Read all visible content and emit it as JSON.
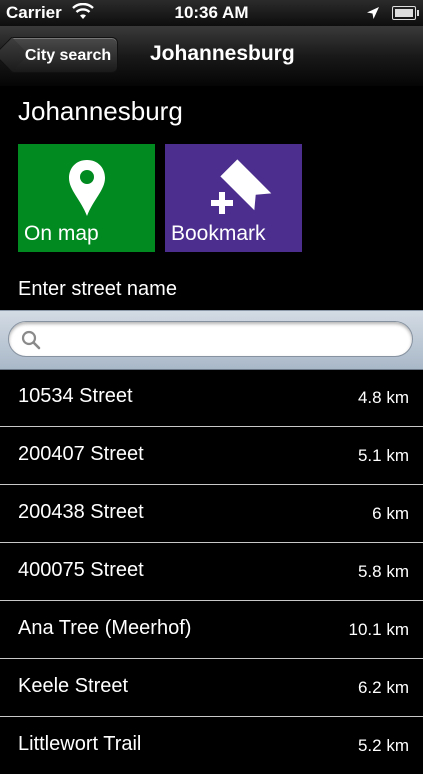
{
  "status_bar": {
    "carrier": "Carrier",
    "time": "10:36 AM",
    "icons": [
      "wifi-icon",
      "location-arrow-icon",
      "battery-icon"
    ]
  },
  "nav": {
    "back_label": "City search",
    "title": "Johannesburg"
  },
  "city": {
    "name": "Johannesburg"
  },
  "actions": {
    "on_map": {
      "label": "On map",
      "icon": "map-pin-icon",
      "color": "#008a1f"
    },
    "bookmark": {
      "label": "Bookmark",
      "icon": "bookmark-add-icon",
      "color": "#4b2e8e"
    }
  },
  "street_prompt": "Enter street name",
  "search": {
    "value": "",
    "placeholder": ""
  },
  "streets": [
    {
      "name": "10534 Street",
      "distance": "4.8 km"
    },
    {
      "name": "200407 Street",
      "distance": "5.1 km"
    },
    {
      "name": "200438 Street",
      "distance": "6 km"
    },
    {
      "name": "400075 Street",
      "distance": "5.8 km"
    },
    {
      "name": "Ana Tree (Meerhof)",
      "distance": "10.1 km"
    },
    {
      "name": "Keele Street",
      "distance": "6.2 km"
    },
    {
      "name": "Littlewort Trail",
      "distance": "5.2 km"
    }
  ]
}
